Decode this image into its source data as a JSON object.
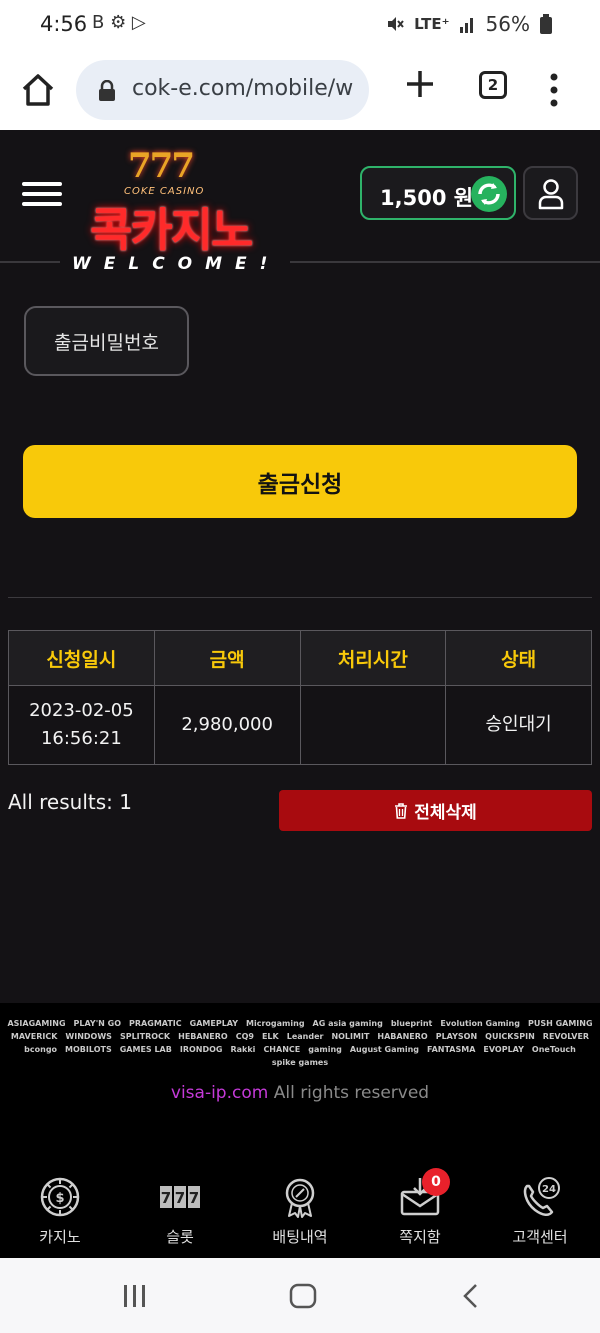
{
  "status": {
    "time": "4:56",
    "left_icons": "B ⚙ ▷",
    "network": "LTE⁺",
    "battery": "56%"
  },
  "browser": {
    "url": "cok-e.com/mobile/w",
    "tab_count": "2"
  },
  "header": {
    "logo_numbers": "777",
    "logo_subtitle": "COKE CASINO",
    "logo_title": "콕카지노",
    "welcome": "WELCOME!",
    "balance": "1,500 원"
  },
  "form": {
    "password_button": "출금비밀번호",
    "withdraw_button": "출금신청"
  },
  "table": {
    "headers": [
      "신청일시",
      "금액",
      "처리시간",
      "상태"
    ],
    "rows": [
      {
        "date": "2023-02-05",
        "time": "16:56:21",
        "amount": "2,980,000",
        "processed": "",
        "status": "승인대기"
      }
    ]
  },
  "results": {
    "label": "All results: 1",
    "delete_all": "전체삭제"
  },
  "footer": {
    "providers": [
      "ASIAGAMING",
      "PLAY'N GO",
      "PRAGMATIC",
      "GAMEPLAY",
      "Microgaming",
      "AG asia gaming",
      "blueprint",
      "Evolution Gaming",
      "PUSH GAMING",
      "MAVERICK",
      "WINDOWS",
      "SPLITROCK",
      "HEBANERO",
      "CQ9",
      "ELK",
      "Leander",
      "NOLIMIT",
      "HABANERO",
      "PLAYSON",
      "QUICKSPIN",
      "REVOLVER",
      "bcongo",
      "MOBILOTS",
      "GAMES LAB",
      "IRONDOG",
      "Rakki",
      "CHANCE",
      "gaming",
      "August Gaming",
      "FANTASMA",
      "EVOPLAY",
      "OneTouch",
      "spike games"
    ],
    "copyright_link": "visa-ip.com",
    "copyright_rest": " All rights reserved"
  },
  "bottom_nav": {
    "items": [
      {
        "label": "카지노",
        "icon": "casino-chip-icon"
      },
      {
        "label": "슬롯",
        "icon": "slot-777-icon"
      },
      {
        "label": "배팅내역",
        "icon": "betting-history-icon"
      },
      {
        "label": "쪽지함",
        "icon": "message-inbox-icon"
      },
      {
        "label": "고객센터",
        "icon": "customer-center-icon"
      }
    ],
    "message_badge": "0"
  },
  "colors": {
    "accent_yellow": "#f8c90a",
    "danger_red": "#a80b0f",
    "balance_green": "#2fb36a",
    "background": "#141215"
  }
}
